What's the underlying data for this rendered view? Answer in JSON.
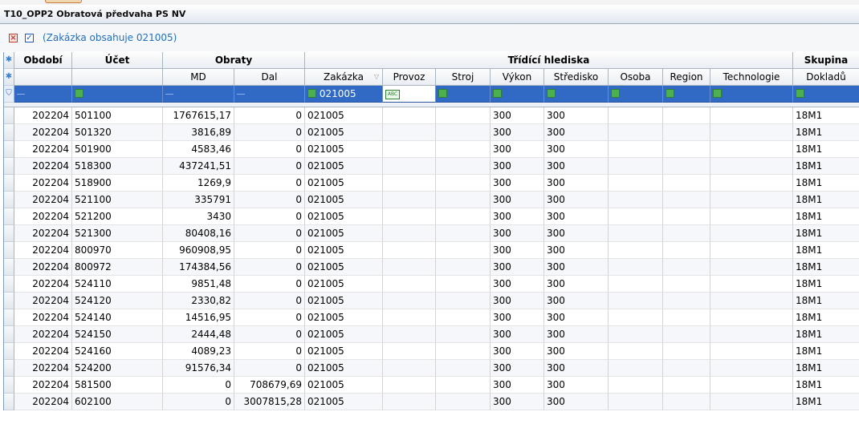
{
  "window": {
    "title": "T10_OPP2 Obratová předvaha PS NV"
  },
  "filter": {
    "text": "(Zakázka obsahuje 021005)",
    "clear_icon": "close-icon",
    "toggle_icon": "checkbox-icon"
  },
  "header": {
    "groups": {
      "obdobi": "Období",
      "ucet": "Účet",
      "obraty": "Obraty",
      "tridici": "Třídící hlediska",
      "skupina": "Skupina"
    },
    "columns": {
      "md": "MD",
      "dal": "Dal",
      "zakazka": "Zakázka",
      "provoz": "Provoz",
      "stroj": "Stroj",
      "vykon": "Výkon",
      "stredisko": "Středisko",
      "osoba": "Osoba",
      "region": "Region",
      "technologie": "Technologie",
      "doklady": "Dokladů"
    }
  },
  "filter_row": {
    "zakazka_value": "021005"
  },
  "rows": [
    {
      "obdobi": "202204",
      "ucet": "501100",
      "md": "1767615,17",
      "dal": "0",
      "zakazka": "021005",
      "vykon": "300",
      "stredisko": "300",
      "skupina": "18M1"
    },
    {
      "obdobi": "202204",
      "ucet": "501320",
      "md": "3816,89",
      "dal": "0",
      "zakazka": "021005",
      "vykon": "300",
      "stredisko": "300",
      "skupina": "18M1"
    },
    {
      "obdobi": "202204",
      "ucet": "501900",
      "md": "4583,46",
      "dal": "0",
      "zakazka": "021005",
      "vykon": "300",
      "stredisko": "300",
      "skupina": "18M1"
    },
    {
      "obdobi": "202204",
      "ucet": "518300",
      "md": "437241,51",
      "dal": "0",
      "zakazka": "021005",
      "vykon": "300",
      "stredisko": "300",
      "skupina": "18M1"
    },
    {
      "obdobi": "202204",
      "ucet": "518900",
      "md": "1269,9",
      "dal": "0",
      "zakazka": "021005",
      "vykon": "300",
      "stredisko": "300",
      "skupina": "18M1"
    },
    {
      "obdobi": "202204",
      "ucet": "521100",
      "md": "335791",
      "dal": "0",
      "zakazka": "021005",
      "vykon": "300",
      "stredisko": "300",
      "skupina": "18M1"
    },
    {
      "obdobi": "202204",
      "ucet": "521200",
      "md": "3430",
      "dal": "0",
      "zakazka": "021005",
      "vykon": "300",
      "stredisko": "300",
      "skupina": "18M1"
    },
    {
      "obdobi": "202204",
      "ucet": "521300",
      "md": "80408,16",
      "dal": "0",
      "zakazka": "021005",
      "vykon": "300",
      "stredisko": "300",
      "skupina": "18M1"
    },
    {
      "obdobi": "202204",
      "ucet": "800970",
      "md": "960908,95",
      "dal": "0",
      "zakazka": "021005",
      "vykon": "300",
      "stredisko": "300",
      "skupina": "18M1"
    },
    {
      "obdobi": "202204",
      "ucet": "800972",
      "md": "174384,56",
      "dal": "0",
      "zakazka": "021005",
      "vykon": "300",
      "stredisko": "300",
      "skupina": "18M1"
    },
    {
      "obdobi": "202204",
      "ucet": "524110",
      "md": "9851,48",
      "dal": "0",
      "zakazka": "021005",
      "vykon": "300",
      "stredisko": "300",
      "skupina": "18M1"
    },
    {
      "obdobi": "202204",
      "ucet": "524120",
      "md": "2330,82",
      "dal": "0",
      "zakazka": "021005",
      "vykon": "300",
      "stredisko": "300",
      "skupina": "18M1"
    },
    {
      "obdobi": "202204",
      "ucet": "524140",
      "md": "14516,95",
      "dal": "0",
      "zakazka": "021005",
      "vykon": "300",
      "stredisko": "300",
      "skupina": "18M1"
    },
    {
      "obdobi": "202204",
      "ucet": "524150",
      "md": "2444,48",
      "dal": "0",
      "zakazka": "021005",
      "vykon": "300",
      "stredisko": "300",
      "skupina": "18M1"
    },
    {
      "obdobi": "202204",
      "ucet": "524160",
      "md": "4089,23",
      "dal": "0",
      "zakazka": "021005",
      "vykon": "300",
      "stredisko": "300",
      "skupina": "18M1"
    },
    {
      "obdobi": "202204",
      "ucet": "524200",
      "md": "91576,34",
      "dal": "0",
      "zakazka": "021005",
      "vykon": "300",
      "stredisko": "300",
      "skupina": "18M1"
    },
    {
      "obdobi": "202204",
      "ucet": "581500",
      "md": "0",
      "dal": "708679,69",
      "zakazka": "021005",
      "vykon": "300",
      "stredisko": "300",
      "skupina": "18M1"
    },
    {
      "obdobi": "202204",
      "ucet": "602100",
      "md": "0",
      "dal": "3007815,28",
      "zakazka": "021005",
      "vykon": "300",
      "stredisko": "300",
      "skupina": "18M1"
    }
  ]
}
